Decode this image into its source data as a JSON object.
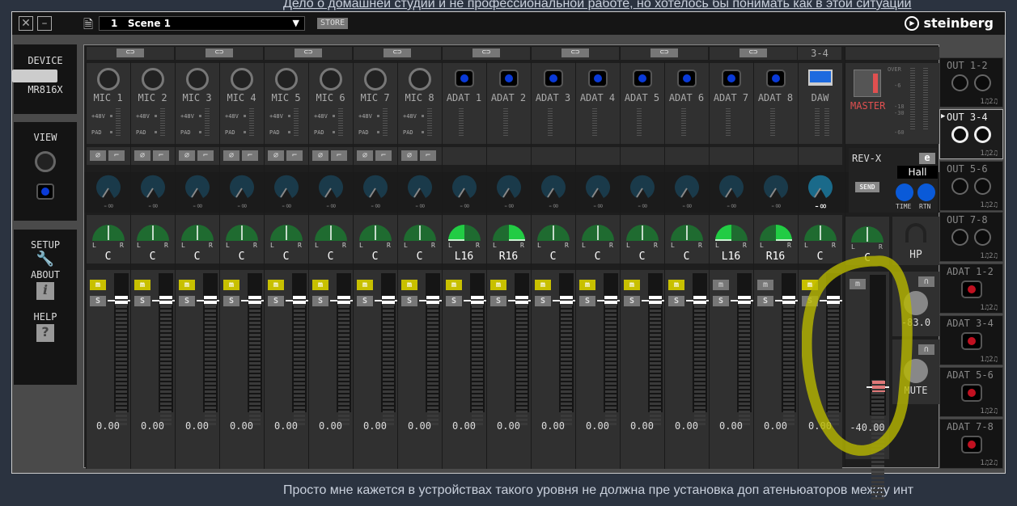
{
  "background_text": {
    "top": "Дело о домашней студии и не профессиональной работе, но хотелось бы понимать как в этой ситуации",
    "bottom": "Просто мне кажется в устройствах такого уровня не должна пре установка доп атеньюаторов между инт"
  },
  "titlebar": {
    "close": "☒",
    "minimize": "–",
    "scene_number": "1",
    "scene_name": "Scene 1",
    "store": "STORE",
    "brand": "steinberg"
  },
  "sidebar": {
    "device": "DEVICE",
    "device_model": "MR816X",
    "view": "VIEW",
    "setup": "SETUP",
    "about": "ABOUT",
    "help": "HELP"
  },
  "channels": [
    {
      "name": "MIC 1",
      "type": "xlr",
      "phantom": "+48V",
      "pad": "PAD",
      "send": "-∞",
      "pan": "C",
      "pan_side": "c",
      "mute": true,
      "level": "0.00"
    },
    {
      "name": "MIC 2",
      "type": "xlr",
      "phantom": "+48V",
      "pad": "PAD",
      "send": "-∞",
      "pan": "C",
      "pan_side": "c",
      "mute": true,
      "level": "0.00"
    },
    {
      "name": "MIC 3",
      "type": "xlr",
      "phantom": "+48V",
      "pad": "PAD",
      "send": "-∞",
      "pan": "C",
      "pan_side": "c",
      "mute": true,
      "level": "0.00"
    },
    {
      "name": "MIC 4",
      "type": "xlr",
      "phantom": "+48V",
      "pad": "PAD",
      "send": "-∞",
      "pan": "C",
      "pan_side": "c",
      "mute": true,
      "level": "0.00"
    },
    {
      "name": "MIC 5",
      "type": "xlr",
      "phantom": "+48V",
      "pad": "PAD",
      "send": "-∞",
      "pan": "C",
      "pan_side": "c",
      "mute": true,
      "level": "0.00"
    },
    {
      "name": "MIC 6",
      "type": "xlr",
      "phantom": "+48V",
      "pad": "PAD",
      "send": "-∞",
      "pan": "C",
      "pan_side": "c",
      "mute": true,
      "level": "0.00"
    },
    {
      "name": "MIC 7",
      "type": "xlr",
      "phantom": "+48V",
      "pad": "PAD",
      "send": "-∞",
      "pan": "C",
      "pan_side": "c",
      "mute": true,
      "level": "0.00"
    },
    {
      "name": "MIC 8",
      "type": "xlr",
      "phantom": "+48V",
      "pad": "PAD",
      "send": "-∞",
      "pan": "C",
      "pan_side": "c",
      "mute": true,
      "level": "0.00"
    },
    {
      "name": "ADAT 1",
      "type": "adat",
      "send": "-∞",
      "pan": "L16",
      "pan_side": "l",
      "mute": true,
      "level": "0.00"
    },
    {
      "name": "ADAT 2",
      "type": "adat",
      "send": "-∞",
      "pan": "R16",
      "pan_side": "r",
      "mute": true,
      "level": "0.00"
    },
    {
      "name": "ADAT 3",
      "type": "adat",
      "send": "-∞",
      "pan": "C",
      "pan_side": "c",
      "mute": true,
      "level": "0.00"
    },
    {
      "name": "ADAT 4",
      "type": "adat",
      "send": "-∞",
      "pan": "C",
      "pan_side": "c",
      "mute": true,
      "level": "0.00"
    },
    {
      "name": "ADAT 5",
      "type": "adat",
      "send": "-∞",
      "pan": "C",
      "pan_side": "c",
      "mute": true,
      "level": "0.00"
    },
    {
      "name": "ADAT 6",
      "type": "adat",
      "send": "-∞",
      "pan": "C",
      "pan_side": "c",
      "mute": true,
      "level": "0.00"
    },
    {
      "name": "ADAT 7",
      "type": "adat",
      "send": "-∞",
      "pan": "L16",
      "pan_side": "l",
      "mute": false,
      "level": "0.00"
    },
    {
      "name": "ADAT 8",
      "type": "adat",
      "send": "-∞",
      "pan": "R16",
      "pan_side": "r",
      "mute": false,
      "level": "0.00"
    },
    {
      "name": "DAW",
      "type": "daw",
      "header": "3-4",
      "send": "-∞",
      "pan": "C",
      "pan_side": "c",
      "mute": true,
      "level": "0.00"
    }
  ],
  "master": {
    "label": "MASTER",
    "meter_scale": [
      "OVER",
      "-6",
      "-18",
      "-30",
      "-60"
    ],
    "pan_label_l": "L",
    "pan_label_r": "R",
    "pan": "C",
    "level": "-40.00",
    "mute_label": "m",
    "reverb": {
      "name": "REV-X",
      "edit": "e",
      "type": "Hall",
      "send": "SEND",
      "time": "TIME",
      "rtn": "RTN"
    },
    "hp": "HP",
    "phones1_level": "-83.0",
    "phones2_level": "MUTE"
  },
  "labels": {
    "L": "L",
    "R": "R",
    "solo": "S",
    "mute": "m"
  },
  "outputs": [
    {
      "name": "OUT 1-2",
      "type": "analog",
      "selected": false
    },
    {
      "name": "OUT 3-4",
      "type": "analog",
      "selected": true
    },
    {
      "name": "OUT 5-6",
      "type": "analog",
      "selected": false
    },
    {
      "name": "OUT 7-8",
      "type": "analog",
      "selected": false
    },
    {
      "name": "ADAT 1-2",
      "type": "adat",
      "selected": false
    },
    {
      "name": "ADAT 3-4",
      "type": "adat",
      "selected": false
    },
    {
      "name": "ADAT 5-6",
      "type": "adat",
      "selected": false
    },
    {
      "name": "ADAT 7-8",
      "type": "adat",
      "selected": false
    }
  ],
  "phones_routing": "1♫2♫",
  "colors": {
    "mute_active": "#c8c000",
    "pan_green": "#1f6b30",
    "pan_bright": "#22cc44",
    "adat_blue": "#0a3ad8",
    "master_red": "#e05050",
    "annotation": "#b8b800"
  }
}
